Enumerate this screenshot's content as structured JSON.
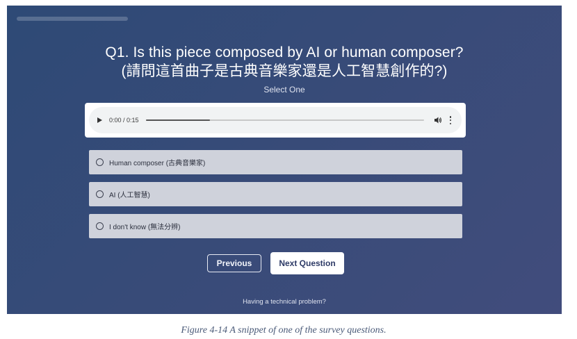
{
  "survey": {
    "question_line1": "Q1. Is this piece composed by AI or human composer?",
    "question_line2": "(請問這首曲子是古典音樂家還是人工智慧創作的?)",
    "select_hint": "Select One",
    "audio": {
      "time": "0:00 / 0:15",
      "progress": 0.23,
      "play_icon": "play-icon",
      "volume_icon": "volume-icon",
      "menu_icon": "more-vertical-icon"
    },
    "options": [
      {
        "label": "Human composer (古典音樂家)"
      },
      {
        "label": "AI (人工智慧)"
      },
      {
        "label": "I don't know (無法分辨)"
      }
    ],
    "prev_label": "Previous",
    "next_label": "Next Question",
    "tech_problem_label": "Having a technical problem?"
  },
  "caption": "Figure 4-14 A snippet of one of the survey questions.",
  "colors": {
    "background_start": "#2e4a76",
    "background_end": "#414c7c",
    "option_bg": "#cfd2db",
    "next_button_text": "#2d3a66",
    "caption_text": "#4a5a78"
  }
}
